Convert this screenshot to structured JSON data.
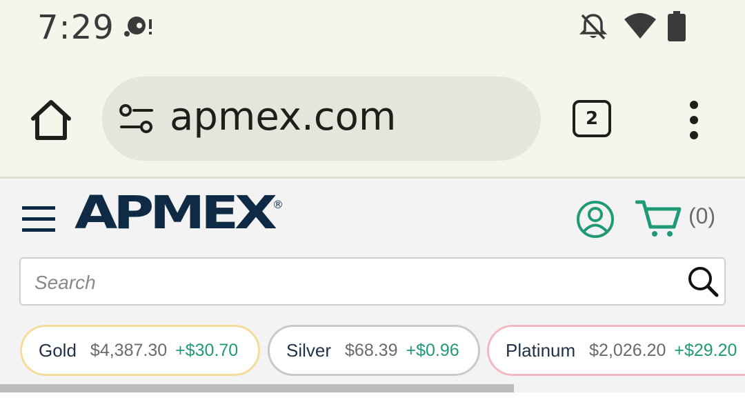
{
  "status_bar": {
    "time": "7:29",
    "icons": [
      "notification-icon",
      "do-not-disturb-bell-icon",
      "wifi-icon",
      "battery-icon"
    ]
  },
  "browser": {
    "url": "apmex.com",
    "tab_count": "2",
    "icons": [
      "home-icon",
      "site-settings-icon",
      "tabs-icon",
      "more-menu-icon"
    ]
  },
  "site": {
    "logo": "APMEX",
    "logo_mark": "®",
    "cart_count": "(0)",
    "search": {
      "placeholder": "Search",
      "value": ""
    },
    "colors": {
      "brand_navy": "#0e2a44",
      "accent_teal": "#1f9a77"
    }
  },
  "metals": [
    {
      "name": "Gold",
      "price": "$4,387.30",
      "change": "+$30.70",
      "border_color": "#f5dc9a"
    },
    {
      "name": "Silver",
      "price": "$68.39",
      "change": "+$0.96",
      "border_color": "#c9c9c9"
    },
    {
      "name": "Platinum",
      "price": "$2,026.20",
      "change": "+$29.20",
      "border_color": "#f3b9c2"
    }
  ],
  "chip_scroll_progress": 0.69
}
